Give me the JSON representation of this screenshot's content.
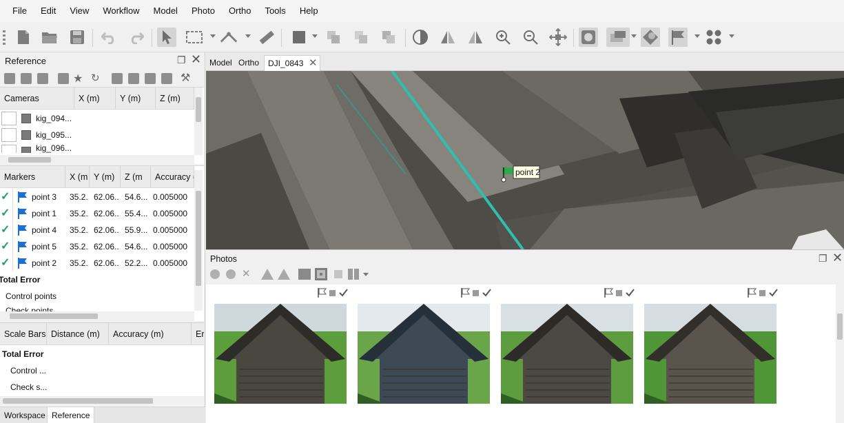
{
  "menu": [
    "File",
    "Edit",
    "View",
    "Workflow",
    "Model",
    "Photo",
    "Ortho",
    "Tools",
    "Help"
  ],
  "toolbar_icons": [
    "new-document",
    "open-folder",
    "save",
    "undo",
    "redo",
    "select-pointer",
    "rectangle-selection",
    "ruler-line",
    "ruler",
    "shape-rect",
    "duplicate",
    "merge",
    "group",
    "contrast",
    "mirror-h",
    "mirror-v",
    "zoom-in",
    "zoom-out",
    "move-center",
    "mask",
    "mask-options",
    "pin",
    "flag",
    "grid-dots"
  ],
  "reference": {
    "title": "Reference",
    "cameras": {
      "headers": [
        "Cameras",
        "X (m)",
        "Y (m)",
        "Z (m)"
      ],
      "rows": [
        "kig_094...",
        "kig_095...",
        "kig_096..."
      ]
    },
    "markers": {
      "headers": [
        "Markers",
        "X (m",
        "Y (m)",
        "Z (m",
        "Accuracy ("
      ],
      "rows": [
        {
          "name": "point 3",
          "x": "35.2...",
          "y": "62.06...",
          "z": "54.6...",
          "acc": "0.005000"
        },
        {
          "name": "point 1",
          "x": "35.2...",
          "y": "62.06...",
          "z": "55.4...",
          "acc": "0.005000"
        },
        {
          "name": "point 4",
          "x": "35.2...",
          "y": "62.06...",
          "z": "55.9...",
          "acc": "0.005000"
        },
        {
          "name": "point 5",
          "x": "35.2...",
          "y": "62.06...",
          "z": "54.6...",
          "acc": "0.005000"
        },
        {
          "name": "point 2",
          "x": "35.2...",
          "y": "62.06...",
          "z": "52.2...",
          "acc": "0.005000"
        }
      ],
      "total_error": "Total Error",
      "control_points": "Control points",
      "check_points": "Check points"
    },
    "scale_bars": {
      "headers": [
        "Scale Bars",
        "Distance (m)",
        "Accuracy (m)",
        "Err"
      ],
      "total_error": "Total Error",
      "control": "Control ...",
      "check": "Check s..."
    }
  },
  "bottom_tabs": [
    "Workspace",
    "Reference"
  ],
  "view_tabs": [
    "Model",
    "Ortho",
    "DJI_0843"
  ],
  "marker_label": "point 2",
  "photos": {
    "title": "Photos",
    "count": 4
  },
  "colors": {
    "accent_blue": "#1c6fd6",
    "check_green": "#1ea35a",
    "marker_flag": "#2fa84f"
  }
}
